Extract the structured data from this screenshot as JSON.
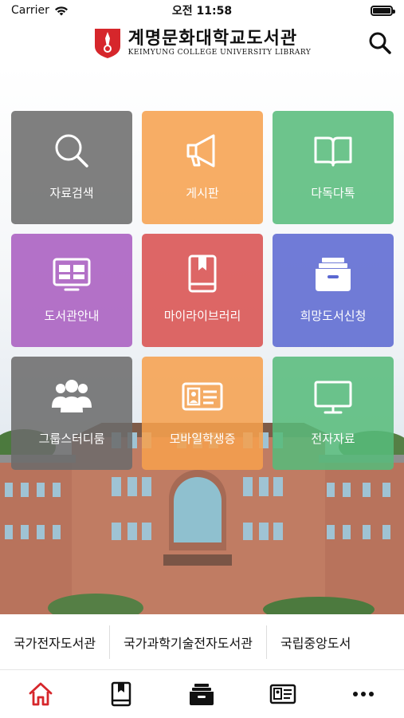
{
  "status_bar": {
    "carrier": "Carrier",
    "time": "오전 11:58"
  },
  "header": {
    "title_ko": "계명문화대학교도서관",
    "title_en": "KEIMYUNG COLLEGE UNIVERSITY LIBRARY",
    "search_icon": "search-icon",
    "brand_color": "#d6262b"
  },
  "tiles": [
    {
      "label": "자료검색",
      "icon": "search-icon",
      "color": "#6b6b6b"
    },
    {
      "label": "게시판",
      "icon": "megaphone-icon",
      "color": "#f6a04d"
    },
    {
      "label": "다독다톡",
      "icon": "book-open-icon",
      "color": "#57bb7a"
    },
    {
      "label": "도서관안내",
      "icon": "info-board-icon",
      "color": "#a85cc0"
    },
    {
      "label": "마이라이브러리",
      "icon": "bookmark-book-icon",
      "color": "#d9504f"
    },
    {
      "label": "희망도서신청",
      "icon": "archive-box-icon",
      "color": "#5b68d1"
    },
    {
      "label": "그룹스터디룸",
      "icon": "group-icon",
      "color": "#6b6b6b"
    },
    {
      "label": "모바일학생증",
      "icon": "id-card-icon",
      "color": "#f6a04d"
    },
    {
      "label": "전자자료",
      "icon": "monitor-icon",
      "color": "#57bb7a"
    }
  ],
  "quick_links": [
    "국가전자도서관",
    "국가과학기술전자도서관",
    "국립중앙도서"
  ],
  "tab_bar": {
    "items": [
      {
        "name": "home-icon",
        "active": true
      },
      {
        "name": "bookmark-book-icon",
        "active": false
      },
      {
        "name": "archive-box-icon",
        "active": false
      },
      {
        "name": "id-card-icon",
        "active": false
      },
      {
        "name": "more-icon",
        "active": false
      }
    ],
    "active_color": "#d6262b"
  }
}
